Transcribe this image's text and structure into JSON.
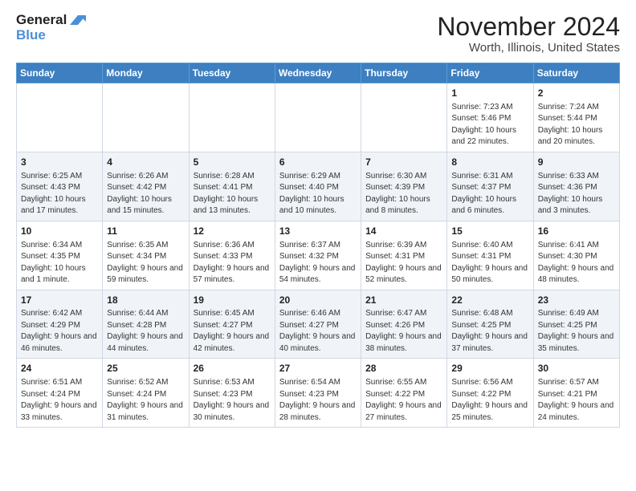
{
  "logo": {
    "line1": "General",
    "line2": "Blue"
  },
  "title": "November 2024",
  "location": "Worth, Illinois, United States",
  "days_of_week": [
    "Sunday",
    "Monday",
    "Tuesday",
    "Wednesday",
    "Thursday",
    "Friday",
    "Saturday"
  ],
  "weeks": [
    [
      {
        "day": "",
        "info": ""
      },
      {
        "day": "",
        "info": ""
      },
      {
        "day": "",
        "info": ""
      },
      {
        "day": "",
        "info": ""
      },
      {
        "day": "",
        "info": ""
      },
      {
        "day": "1",
        "info": "Sunrise: 7:23 AM\nSunset: 5:46 PM\nDaylight: 10 hours and 22 minutes."
      },
      {
        "day": "2",
        "info": "Sunrise: 7:24 AM\nSunset: 5:44 PM\nDaylight: 10 hours and 20 minutes."
      }
    ],
    [
      {
        "day": "3",
        "info": "Sunrise: 6:25 AM\nSunset: 4:43 PM\nDaylight: 10 hours and 17 minutes."
      },
      {
        "day": "4",
        "info": "Sunrise: 6:26 AM\nSunset: 4:42 PM\nDaylight: 10 hours and 15 minutes."
      },
      {
        "day": "5",
        "info": "Sunrise: 6:28 AM\nSunset: 4:41 PM\nDaylight: 10 hours and 13 minutes."
      },
      {
        "day": "6",
        "info": "Sunrise: 6:29 AM\nSunset: 4:40 PM\nDaylight: 10 hours and 10 minutes."
      },
      {
        "day": "7",
        "info": "Sunrise: 6:30 AM\nSunset: 4:39 PM\nDaylight: 10 hours and 8 minutes."
      },
      {
        "day": "8",
        "info": "Sunrise: 6:31 AM\nSunset: 4:37 PM\nDaylight: 10 hours and 6 minutes."
      },
      {
        "day": "9",
        "info": "Sunrise: 6:33 AM\nSunset: 4:36 PM\nDaylight: 10 hours and 3 minutes."
      }
    ],
    [
      {
        "day": "10",
        "info": "Sunrise: 6:34 AM\nSunset: 4:35 PM\nDaylight: 10 hours and 1 minute."
      },
      {
        "day": "11",
        "info": "Sunrise: 6:35 AM\nSunset: 4:34 PM\nDaylight: 9 hours and 59 minutes."
      },
      {
        "day": "12",
        "info": "Sunrise: 6:36 AM\nSunset: 4:33 PM\nDaylight: 9 hours and 57 minutes."
      },
      {
        "day": "13",
        "info": "Sunrise: 6:37 AM\nSunset: 4:32 PM\nDaylight: 9 hours and 54 minutes."
      },
      {
        "day": "14",
        "info": "Sunrise: 6:39 AM\nSunset: 4:31 PM\nDaylight: 9 hours and 52 minutes."
      },
      {
        "day": "15",
        "info": "Sunrise: 6:40 AM\nSunset: 4:31 PM\nDaylight: 9 hours and 50 minutes."
      },
      {
        "day": "16",
        "info": "Sunrise: 6:41 AM\nSunset: 4:30 PM\nDaylight: 9 hours and 48 minutes."
      }
    ],
    [
      {
        "day": "17",
        "info": "Sunrise: 6:42 AM\nSunset: 4:29 PM\nDaylight: 9 hours and 46 minutes."
      },
      {
        "day": "18",
        "info": "Sunrise: 6:44 AM\nSunset: 4:28 PM\nDaylight: 9 hours and 44 minutes."
      },
      {
        "day": "19",
        "info": "Sunrise: 6:45 AM\nSunset: 4:27 PM\nDaylight: 9 hours and 42 minutes."
      },
      {
        "day": "20",
        "info": "Sunrise: 6:46 AM\nSunset: 4:27 PM\nDaylight: 9 hours and 40 minutes."
      },
      {
        "day": "21",
        "info": "Sunrise: 6:47 AM\nSunset: 4:26 PM\nDaylight: 9 hours and 38 minutes."
      },
      {
        "day": "22",
        "info": "Sunrise: 6:48 AM\nSunset: 4:25 PM\nDaylight: 9 hours and 37 minutes."
      },
      {
        "day": "23",
        "info": "Sunrise: 6:49 AM\nSunset: 4:25 PM\nDaylight: 9 hours and 35 minutes."
      }
    ],
    [
      {
        "day": "24",
        "info": "Sunrise: 6:51 AM\nSunset: 4:24 PM\nDaylight: 9 hours and 33 minutes."
      },
      {
        "day": "25",
        "info": "Sunrise: 6:52 AM\nSunset: 4:24 PM\nDaylight: 9 hours and 31 minutes."
      },
      {
        "day": "26",
        "info": "Sunrise: 6:53 AM\nSunset: 4:23 PM\nDaylight: 9 hours and 30 minutes."
      },
      {
        "day": "27",
        "info": "Sunrise: 6:54 AM\nSunset: 4:23 PM\nDaylight: 9 hours and 28 minutes."
      },
      {
        "day": "28",
        "info": "Sunrise: 6:55 AM\nSunset: 4:22 PM\nDaylight: 9 hours and 27 minutes."
      },
      {
        "day": "29",
        "info": "Sunrise: 6:56 AM\nSunset: 4:22 PM\nDaylight: 9 hours and 25 minutes."
      },
      {
        "day": "30",
        "info": "Sunrise: 6:57 AM\nSunset: 4:21 PM\nDaylight: 9 hours and 24 minutes."
      }
    ]
  ]
}
